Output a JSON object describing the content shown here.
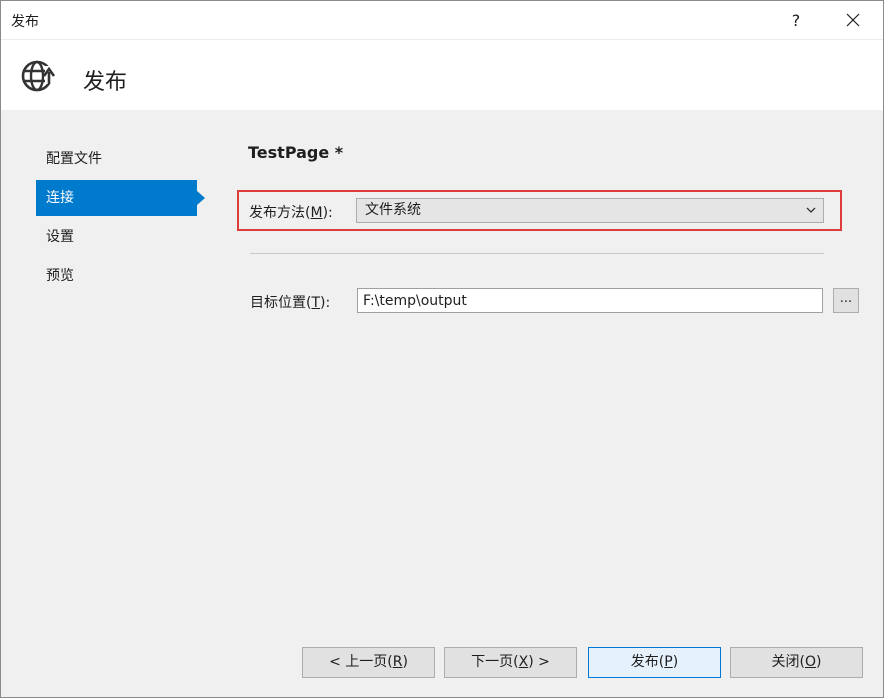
{
  "window": {
    "title": "发布",
    "help_glyph": "?"
  },
  "header": {
    "title": "发布"
  },
  "nav": {
    "items": [
      {
        "label": "配置文件",
        "active": false
      },
      {
        "label": "连接",
        "active": true
      },
      {
        "label": "设置",
        "active": false
      },
      {
        "label": "预览",
        "active": false
      }
    ]
  },
  "main": {
    "profile_name": "TestPage *",
    "publish_method": {
      "label_prefix": "发布方法(",
      "label_key": "M",
      "label_suffix": "):",
      "value": "文件系统"
    },
    "target": {
      "label_prefix": "目标位置(",
      "label_key": "T",
      "label_suffix": "):",
      "value": "F:\\temp\\output",
      "browse_label": "..."
    }
  },
  "footer": {
    "prev": {
      "prefix": "< 上一页(",
      "key": "R",
      "suffix": ")"
    },
    "next": {
      "prefix": "下一页(",
      "key": "X",
      "suffix": ") >"
    },
    "publish": {
      "prefix": "发布(",
      "key": "P",
      "suffix": ")"
    },
    "close": {
      "prefix": "关闭(",
      "key": "O",
      "suffix": ")"
    }
  },
  "colors": {
    "accent": "#007acc",
    "highlight_border": "#e03b3b"
  }
}
